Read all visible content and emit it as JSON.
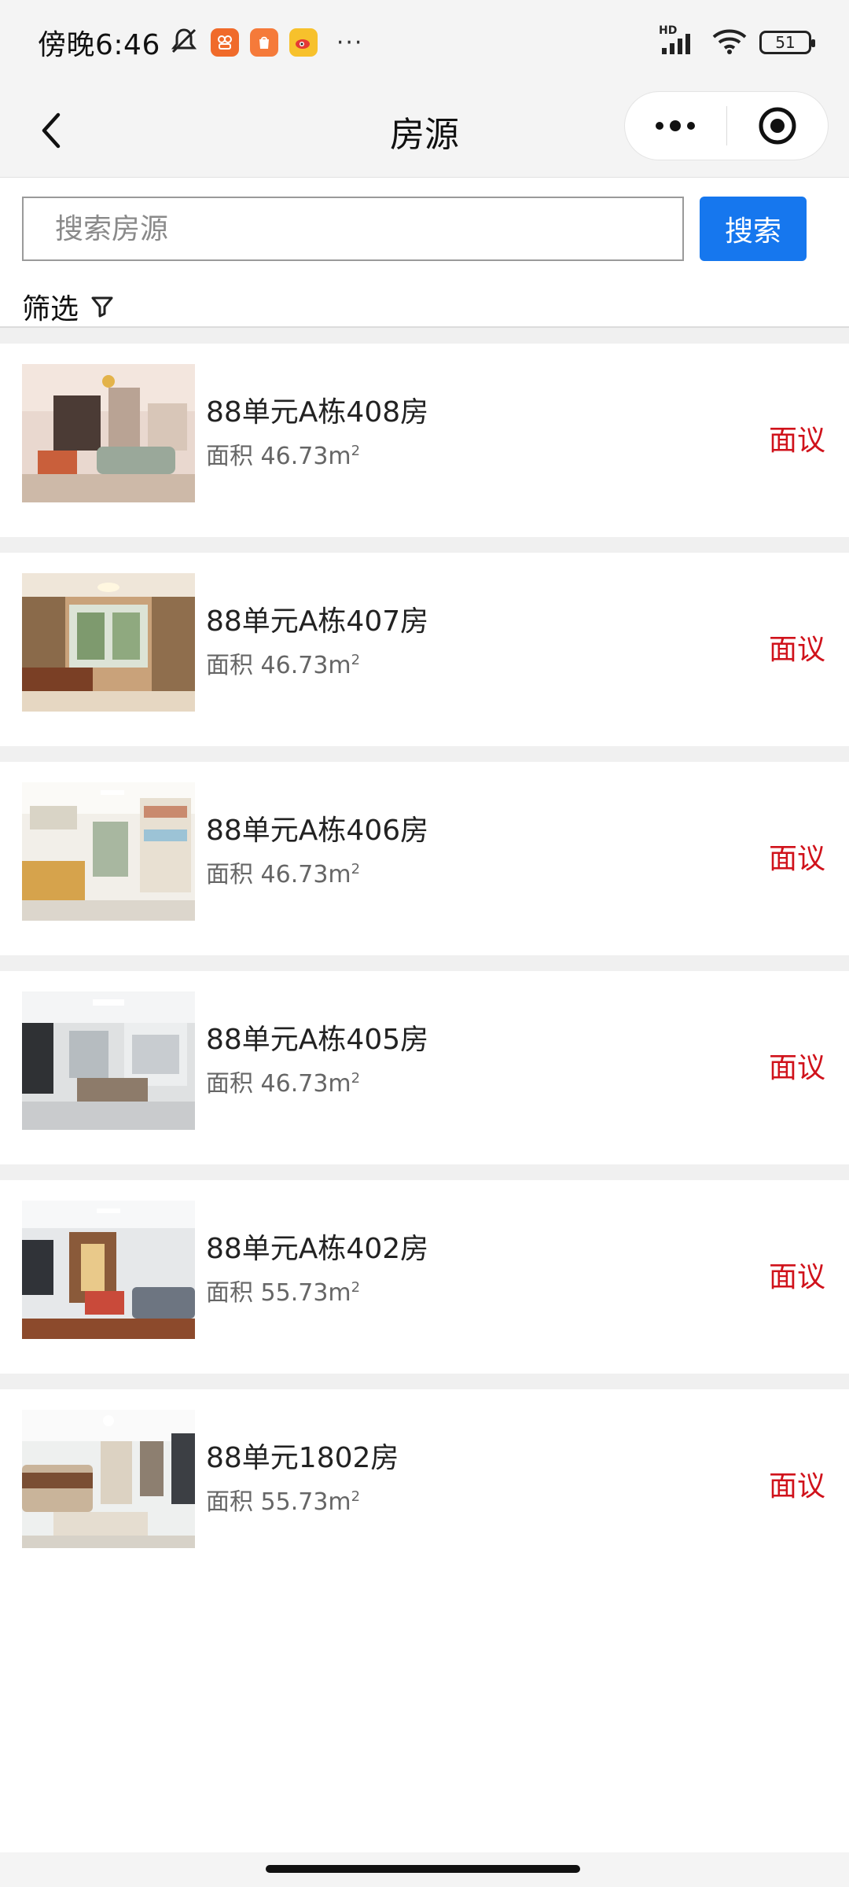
{
  "status_bar": {
    "time": "傍晚6:46",
    "more": "···",
    "network_label": "HD",
    "battery": "51"
  },
  "nav": {
    "title": "房源"
  },
  "search": {
    "placeholder": "搜索房源",
    "value": "",
    "button_label": "搜索"
  },
  "filter": {
    "label": "筛选"
  },
  "listings": [
    {
      "title": "88单元A栋408房",
      "area_prefix": "面积 46.73m",
      "area_sup": "2",
      "price": "面议"
    },
    {
      "title": "88单元A栋407房",
      "area_prefix": "面积 46.73m",
      "area_sup": "2",
      "price": "面议"
    },
    {
      "title": "88单元A栋406房",
      "area_prefix": "面积 46.73m",
      "area_sup": "2",
      "price": "面议"
    },
    {
      "title": "88单元A栋405房",
      "area_prefix": "面积 46.73m",
      "area_sup": "2",
      "price": "面议"
    },
    {
      "title": "88单元A栋402房",
      "area_prefix": "面积 55.73m",
      "area_sup": "2",
      "price": "面议"
    },
    {
      "title": "88单元1802房",
      "area_prefix": "面积 55.73m",
      "area_sup": "2",
      "price": "面议"
    }
  ],
  "colors": {
    "accent": "#1677ee",
    "price": "#d0121b"
  }
}
